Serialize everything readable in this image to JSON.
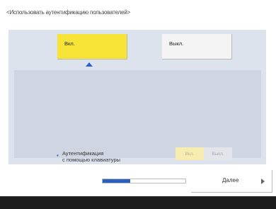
{
  "title": "<Использовать аутентификацию пользователей>",
  "main_toggle": {
    "on_label": "Вкл.",
    "off_label": "Выкл.",
    "selected": "on"
  },
  "keyboard_auth": {
    "label_line1": "Аутентификация",
    "label_line2": "с помощью клавиатуры",
    "on_label": "Вкл.",
    "off_label": "Выкл.",
    "enabled": false
  },
  "progress": {
    "fraction": 0.33
  },
  "next_button": {
    "label": "Далее"
  },
  "colors": {
    "accent_yellow": "#f7e436",
    "accent_blue": "#2b5fb9",
    "panel_bg": "#dde3ec",
    "subpanel_bg": "#cfd6e2",
    "bottom_bar": "#1c1c1c"
  },
  "icons": {
    "selection_pointer": "triangle-up-icon",
    "bullet": "bullet-icon",
    "next_arrow": "triangle-right-icon"
  }
}
